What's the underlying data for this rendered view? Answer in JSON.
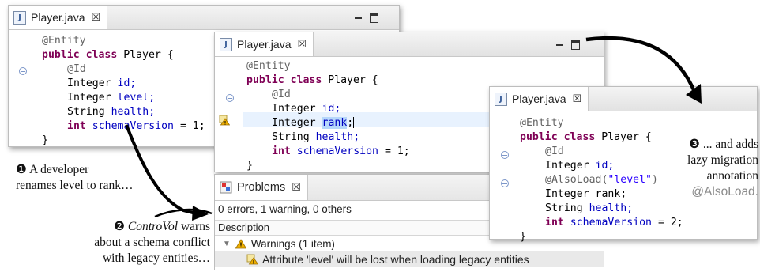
{
  "editor_before": {
    "tab_title": "Player.java",
    "close_glyph": "☒",
    "lines": [
      "@Entity",
      "public class",
      "Player {",
      "@Id",
      "Integer",
      "id;",
      "Integer",
      "level;",
      "String",
      "health;",
      "int",
      "schemaVersion",
      "= 1;",
      "}"
    ]
  },
  "editor_middle": {
    "tab_title": "Player.java",
    "close_glyph": "☒",
    "kw_public_class": "public class",
    "class_name": "Player {",
    "ann_entity": "@Entity",
    "ann_id": "@Id",
    "type_integer": "Integer",
    "field_id": "id;",
    "field_rank": "rank",
    "semicolon": ";",
    "type_string": "String",
    "field_health": "health;",
    "kw_int": "int",
    "field_schema": "schemaVersion",
    "assign_1": "= 1;",
    "close_brace": "}"
  },
  "problems": {
    "tab_title": "Problems",
    "close_glyph": "☒",
    "summary": "0 errors, 1 warning, 0 others",
    "column_header": "Description",
    "group_label": "Warnings (1 item)",
    "warning_message": "Attribute 'level' will be lost when loading legacy entities"
  },
  "editor_after": {
    "tab_title": "Player.java",
    "close_glyph": "☒",
    "ann_entity": "@Entity",
    "kw_public_class": "public class",
    "class_name": "Player {",
    "ann_id": "@Id",
    "type_integer": "Integer",
    "field_id": "id;",
    "ann_alsoload": "@AlsoLoad(",
    "alsoload_value": "\"level\"",
    "ann_close": ")",
    "field_rank": "rank;",
    "type_string": "String",
    "field_health": "health;",
    "kw_int": "int",
    "field_schema": "schemaVersion",
    "assign_2": "= 2;",
    "close_brace": "}"
  },
  "notes": {
    "step1_num": "❶",
    "step1_line1": "A developer",
    "step1_line2": "renames level to rank…",
    "step2_num": "❷",
    "step2_tool": "ControVol",
    "step2_line1_rest": "warns",
    "step2_line2": "about a schema conflict",
    "step2_line3": "with legacy entities…",
    "step3_num": "❸",
    "step3_line1": "... and adds",
    "step3_line2": "lazy migration",
    "step3_line3": "annotation",
    "step3_line4": "@AlsoLoad."
  },
  "colors": {
    "keyword": "#7f0055",
    "field": "#0000c0",
    "annotation": "#646464",
    "string": "#2a00ff",
    "warning": "#e8a200",
    "selection": "#b6d7fb"
  }
}
